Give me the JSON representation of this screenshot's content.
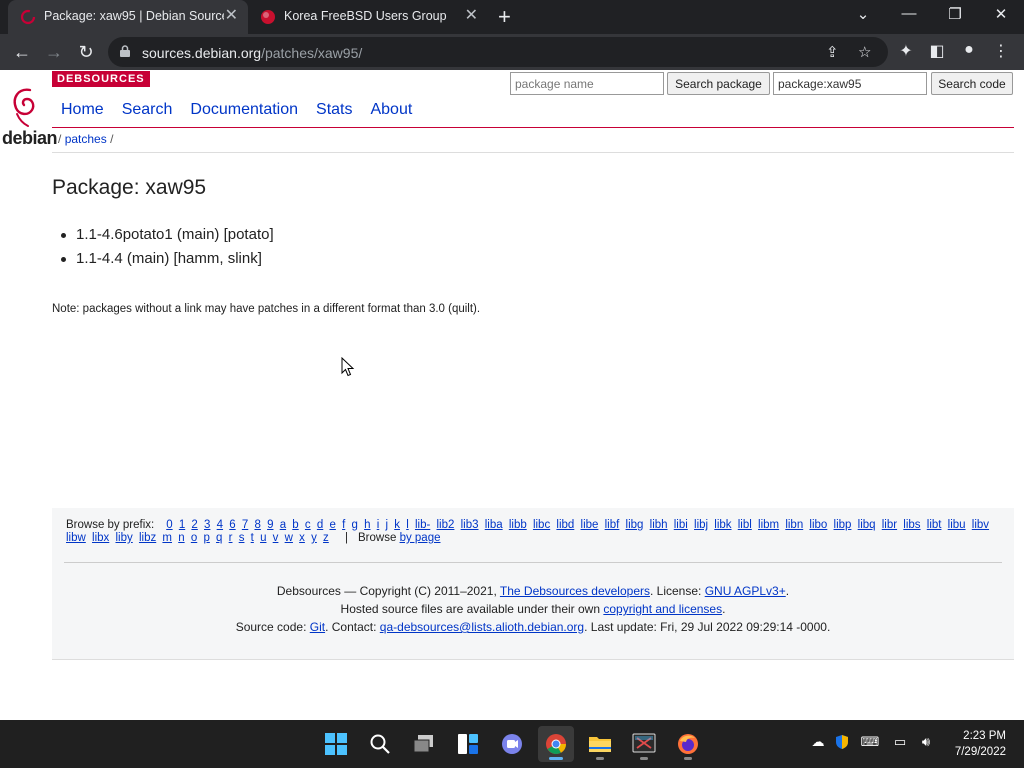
{
  "browser": {
    "tabs": [
      {
        "title": "Package: xaw95 | Debian Sources",
        "active": true
      },
      {
        "title": "Korea FreeBSD Users Group",
        "active": false
      }
    ],
    "url_host": "sources.debian.org",
    "url_path": "/patches/xaw95/"
  },
  "site": {
    "badge": "DEBSOURCES",
    "logo_text": "debian",
    "search": {
      "package_placeholder": "package name",
      "package_button": "Search package",
      "code_value": "package:xaw95",
      "code_button": "Search code"
    },
    "nav": [
      "Home",
      "Search",
      "Documentation",
      "Stats",
      "About"
    ],
    "breadcrumb": {
      "sep1": "/",
      "link": "patches",
      "sep2": "/"
    }
  },
  "content": {
    "title": "Package: xaw95",
    "versions": [
      "1.1-4.6potato1 (main) [potato]",
      "1.1-4.4 (main) [hamm, slink]"
    ],
    "note": "Note: packages without a link may have patches in a different format than 3.0 (quilt)."
  },
  "footer": {
    "browse_label": "Browse by prefix:",
    "prefixes": [
      "0",
      "1",
      "2",
      "3",
      "4",
      "6",
      "7",
      "8",
      "9",
      "a",
      "b",
      "c",
      "d",
      "e",
      "f",
      "g",
      "h",
      "i",
      "j",
      "k",
      "l",
      "lib-",
      "lib2",
      "lib3",
      "liba",
      "libb",
      "libc",
      "libd",
      "libe",
      "libf",
      "libg",
      "libh",
      "libi",
      "libj",
      "libk",
      "libl",
      "libm",
      "libn",
      "libo",
      "libp",
      "libq",
      "libr",
      "libs",
      "libt",
      "libu",
      "libv",
      "libw",
      "libx",
      "liby",
      "libz",
      "m",
      "n",
      "o",
      "p",
      "q",
      "r",
      "s",
      "t",
      "u",
      "v",
      "w",
      "x",
      "y",
      "z"
    ],
    "browse_sep": "|",
    "browse_page_text": "Browse",
    "browse_page_link": "by page",
    "line1_a": "Debsources — Copyright (C) 2011–2021, ",
    "line1_link1": "The Debsources developers",
    "line1_b": ". License: ",
    "line1_link2": "GNU AGPLv3+",
    "line1_c": ".",
    "line2_a": "Hosted source files are available under their own ",
    "line2_link": "copyright and licenses",
    "line2_b": ".",
    "line3_a": "Source code: ",
    "line3_link1": "Git",
    "line3_b": ". Contact: ",
    "line3_link2": "qa-debsources@lists.alioth.debian.org",
    "line3_c": ". Last update: Fri, 29 Jul 2022 09:29:14 -0000."
  },
  "taskbar": {
    "time": "2:23 PM",
    "date": "7/29/2022",
    "apps": [
      "start",
      "search",
      "task-view",
      "widgets",
      "teams-chat",
      "chrome",
      "file-explorer",
      "snipping-tool",
      "firefox"
    ]
  },
  "colors": {
    "debian_red": "#c70036",
    "link_blue": "#0035c7",
    "chrome_dark": "#202124",
    "chrome_toolbar": "#35363a"
  }
}
